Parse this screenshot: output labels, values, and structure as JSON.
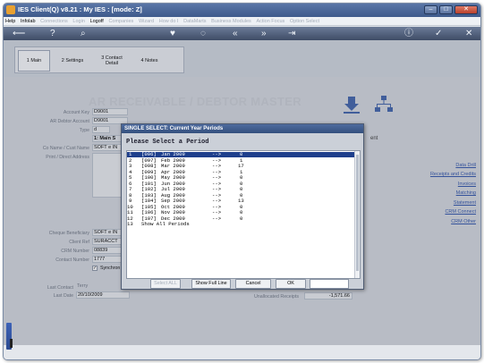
{
  "window": {
    "title": "IES Client(Q) v8.21 : My IES :        [mode: Z]",
    "controls": {
      "minimize": "–",
      "maximize": "□",
      "close": "✕"
    }
  },
  "menubar": {
    "items": [
      {
        "label": "Help",
        "enabled": true
      },
      {
        "label": "Infolab",
        "enabled": true
      },
      {
        "label": "Connections",
        "enabled": false
      },
      {
        "label": "Login",
        "enabled": false
      },
      {
        "label": "Logoff",
        "enabled": true
      },
      {
        "label": "Companies",
        "enabled": false
      },
      {
        "label": "Wizard",
        "enabled": false
      },
      {
        "label": "How do I",
        "enabled": false
      },
      {
        "label": "DataMarts",
        "enabled": false
      },
      {
        "label": "Business Modules",
        "enabled": false
      },
      {
        "label": "Action Focus",
        "enabled": false
      },
      {
        "label": "Option Select",
        "enabled": false
      }
    ]
  },
  "toolbar": {
    "icons": [
      "back-arrow-icon",
      "help-icon",
      "search-icon",
      "heart-icon",
      "ring-icon",
      "rewind-icon",
      "fast-forward-icon",
      "skip-end-icon",
      "info-icon",
      "checkmark-icon",
      "close-icon"
    ],
    "glyphs": [
      "⟵",
      "?",
      "⌕",
      "♥",
      "◌",
      "«",
      "»",
      "⇥",
      "ⓘ",
      "✓",
      "✕"
    ]
  },
  "tabs": [
    {
      "label": "1 Main",
      "active": true
    },
    {
      "label": "2 Settings",
      "active": false
    },
    {
      "label": "3 Contact Detail",
      "active": false
    },
    {
      "label": "4 Notes",
      "active": false
    }
  ],
  "screen": {
    "heading": "AR RECEIVABLE / DEBTOR MASTER",
    "fields": [
      {
        "label": "Account Key",
        "value": "D9001"
      },
      {
        "label": "AR Debtor Account",
        "value": "D9001"
      },
      {
        "label": "Type",
        "value": "d"
      },
      {
        "label": "Main S",
        "value": "1: Main S"
      },
      {
        "label": "Co Name / Cust Name",
        "value": "SOFT e IN"
      },
      {
        "label": "Print / Direct Address",
        "value": ""
      },
      {
        "label": "Cheque Beneficiary",
        "value": "SOFT e IN"
      },
      {
        "label": "Client Ref",
        "value": "SURACCT"
      },
      {
        "label": "CRM Number",
        "value": "08839"
      },
      {
        "label": "Contact Number",
        "value": "1777"
      },
      {
        "label": "Synchron",
        "value": "Synchron"
      },
      {
        "label": "Last Contact",
        "value": "Terry"
      },
      {
        "label": "Last Date",
        "value": "20/10/2009"
      }
    ],
    "right_label": "ent",
    "bottom_label": "Unallocated Receipts",
    "bottom_value": "-1,571.66",
    "links": [
      "Data Drill",
      "Receipts and Credits",
      "Invoices",
      "Matching",
      "Statement",
      "CRM Connect",
      "CRM Other"
    ]
  },
  "dialog": {
    "title": "SINGLE SELECT: Current Year Periods",
    "prompt": "Please Select a Period",
    "rows": [
      {
        "num": "1",
        "code": "[096]",
        "period": "Jan 2009",
        "arrow": "-->",
        "count": "0",
        "selected": true
      },
      {
        "num": "2",
        "code": "[097]",
        "period": "Feb 2009",
        "arrow": "-->",
        "count": "1",
        "selected": false
      },
      {
        "num": "3",
        "code": "[098]",
        "period": "Mar 2009",
        "arrow": "-->",
        "count": "17",
        "selected": false
      },
      {
        "num": "4",
        "code": "[099]",
        "period": "Apr 2009",
        "arrow": "-->",
        "count": "1",
        "selected": false
      },
      {
        "num": "5",
        "code": "[100]",
        "period": "May 2009",
        "arrow": "-->",
        "count": "0",
        "selected": false
      },
      {
        "num": "6",
        "code": "[101]",
        "period": "Jun 2009",
        "arrow": "-->",
        "count": "0",
        "selected": false
      },
      {
        "num": "7",
        "code": "[102]",
        "period": "Jul 2009",
        "arrow": "-->",
        "count": "0",
        "selected": false
      },
      {
        "num": "8",
        "code": "[103]",
        "period": "Aug 2009",
        "arrow": "-->",
        "count": "0",
        "selected": false
      },
      {
        "num": "9",
        "code": "[104]",
        "period": "Sep 2009",
        "arrow": "-->",
        "count": "13",
        "selected": false
      },
      {
        "num": "10",
        "code": "[105]",
        "period": "Oct 2009",
        "arrow": "-->",
        "count": "0",
        "selected": false
      },
      {
        "num": "11",
        "code": "[106]",
        "period": "Nov 2009",
        "arrow": "-->",
        "count": "0",
        "selected": false
      },
      {
        "num": "12",
        "code": "[107]",
        "period": "Dec 2009",
        "arrow": "-->",
        "count": "0",
        "selected": false
      },
      {
        "num": "13",
        "code": "",
        "period": "Show All Periods",
        "arrow": "",
        "count": "",
        "selected": false
      }
    ],
    "buttons": {
      "select_all": "Select ALL",
      "show_full_line": "Show Full Line",
      "cancel": "Cancel",
      "ok": "OK"
    }
  },
  "colors": {
    "title_bar": "#3e5a8c",
    "selection": "#1e3f8c",
    "link": "#2a4fa8",
    "toolbar": "#4a5874"
  }
}
